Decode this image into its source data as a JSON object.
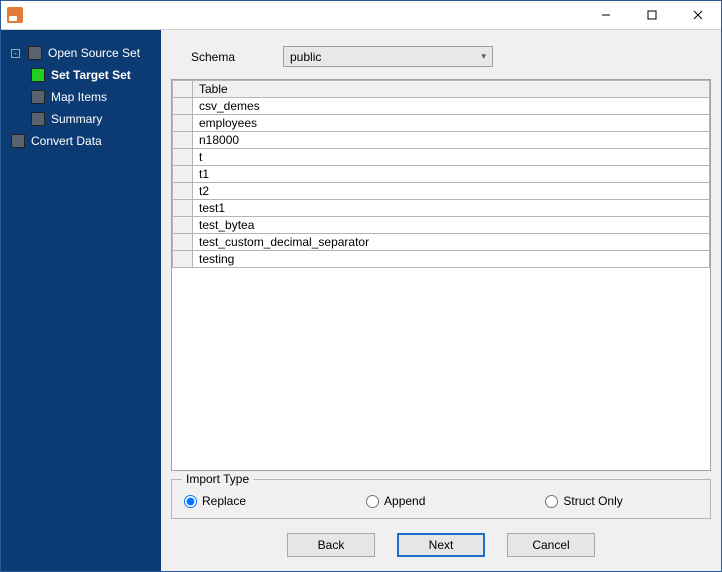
{
  "titlebar": {
    "title": ""
  },
  "sidebar": {
    "items": [
      {
        "label": "Open Source Set",
        "active": false,
        "child": false,
        "expandable": true
      },
      {
        "label": "Set Target Set",
        "active": true,
        "child": true,
        "expandable": false
      },
      {
        "label": "Map Items",
        "active": false,
        "child": true,
        "expandable": false
      },
      {
        "label": "Summary",
        "active": false,
        "child": true,
        "expandable": false
      },
      {
        "label": "Convert Data",
        "active": false,
        "child": false,
        "expandable": false
      }
    ]
  },
  "schema": {
    "label": "Schema",
    "selected": "public"
  },
  "table": {
    "header": "Table",
    "rows": [
      "csv_demes",
      "employees",
      "n18000",
      "t",
      "t1",
      "t2",
      "test1",
      "test_bytea",
      "test_custom_decimal_separator",
      "testing"
    ]
  },
  "importType": {
    "legend": "Import Type",
    "options": [
      {
        "label": "Replace",
        "checked": true
      },
      {
        "label": "Append",
        "checked": false
      },
      {
        "label": "Struct Only",
        "checked": false
      }
    ]
  },
  "buttons": {
    "back": "Back",
    "next": "Next",
    "cancel": "Cancel"
  }
}
